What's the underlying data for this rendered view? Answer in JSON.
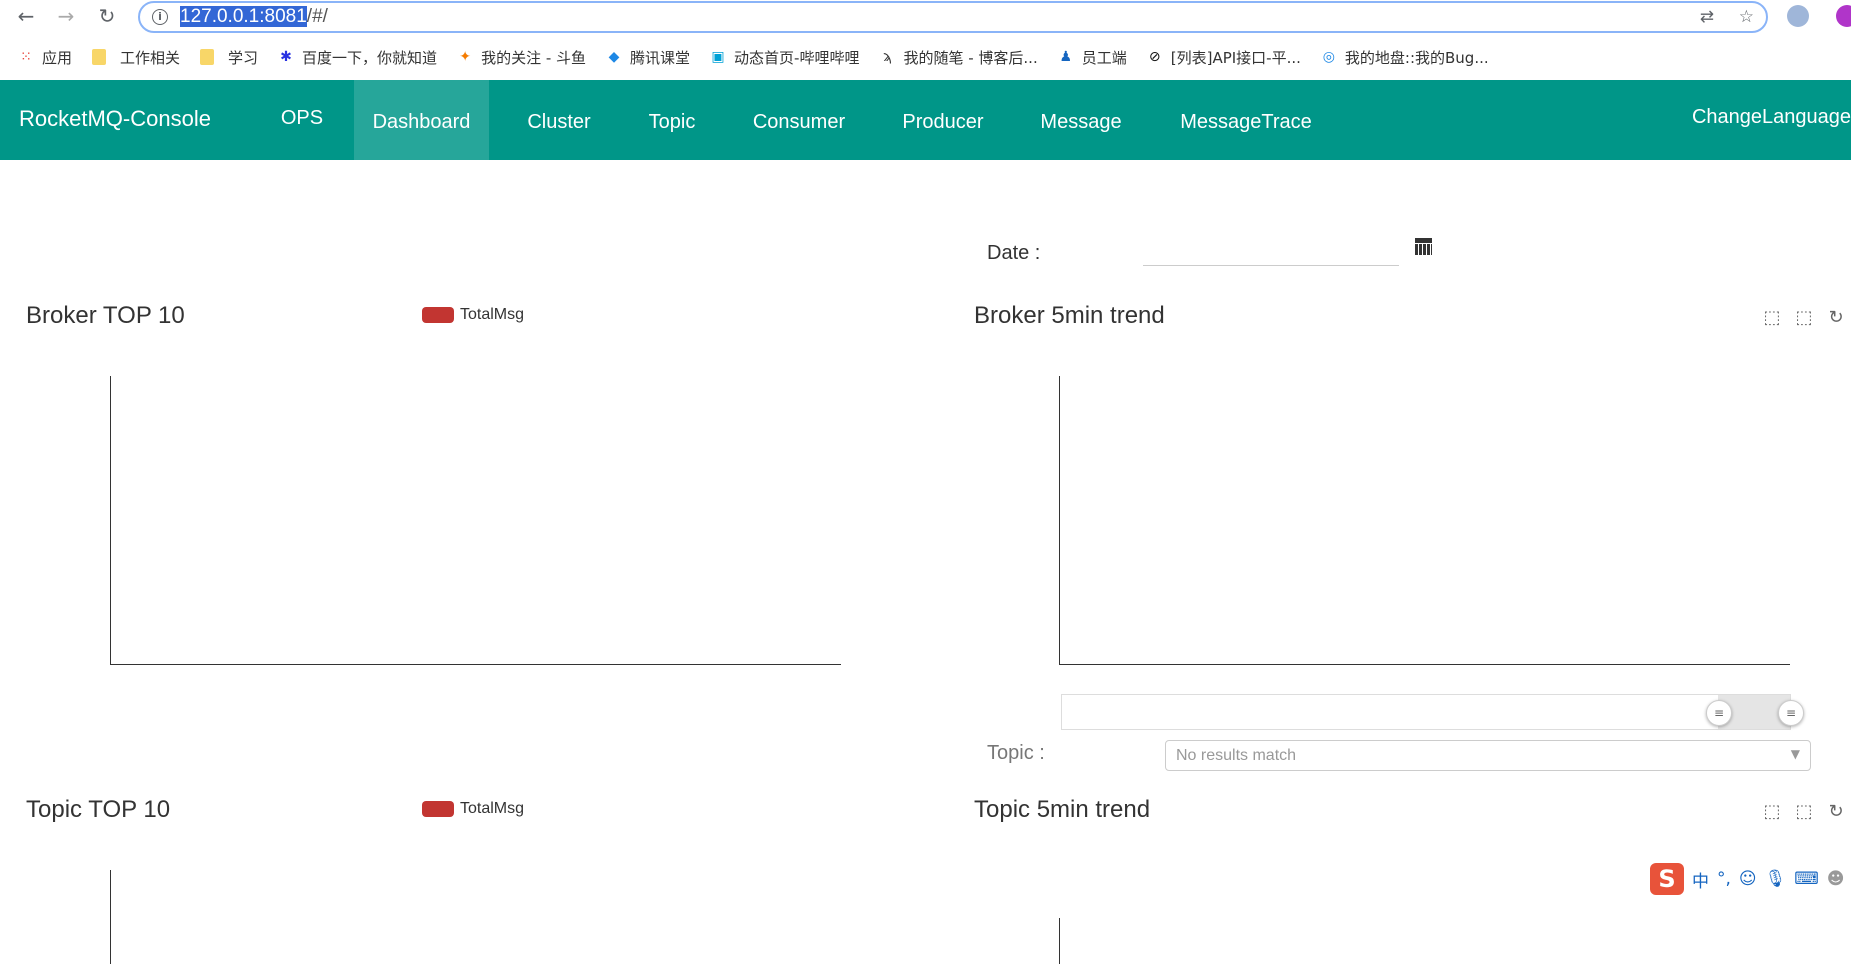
{
  "browser": {
    "url_host": "127.0.0.1:8081",
    "url_path": "/#/",
    "bookmarks": [
      {
        "label": "应用",
        "icon": "apps-grid-icon"
      },
      {
        "label": "工作相关",
        "icon": "folder-icon"
      },
      {
        "label": "学习",
        "icon": "folder-icon"
      },
      {
        "label": "百度一下，你就知道",
        "icon": "baidu-icon"
      },
      {
        "label": "我的关注 - 斗鱼",
        "icon": "douyu-icon"
      },
      {
        "label": "腾讯课堂",
        "icon": "tencent-classroom-icon"
      },
      {
        "label": "动态首页-哔哩哔哩",
        "icon": "bilibili-icon"
      },
      {
        "label": "我的随笔 - 博客后...",
        "icon": "cnblogs-icon"
      },
      {
        "label": "员工端",
        "icon": "staff-icon"
      },
      {
        "label": "[列表]API接口-平...",
        "icon": "api-icon"
      },
      {
        "label": "我的地盘::我的Bug...",
        "icon": "zentao-icon"
      }
    ]
  },
  "navbar": {
    "brand": "RocketMQ-Console",
    "ops": "OPS",
    "items": [
      "Dashboard",
      "Cluster",
      "Topic",
      "Consumer",
      "Producer",
      "Message",
      "MessageTrace"
    ],
    "active": "Dashboard",
    "change_language": "ChangeLanguage"
  },
  "filters": {
    "date_label": "Date :",
    "date_value": "",
    "topic_label": "Topic :",
    "topic_placeholder": "No results match"
  },
  "panels": {
    "broker_top": {
      "title": "Broker TOP 10",
      "legend": "TotalMsg"
    },
    "broker_trend": {
      "title": "Broker 5min trend"
    },
    "topic_top": {
      "title": "Topic TOP 10",
      "legend": "TotalMsg"
    },
    "topic_trend": {
      "title": "Topic 5min trend"
    }
  },
  "colors": {
    "navbar": "#009688",
    "nav_active": "#26a69a",
    "legend_swatch": "#c23531"
  },
  "ime": {
    "mode": "中"
  }
}
